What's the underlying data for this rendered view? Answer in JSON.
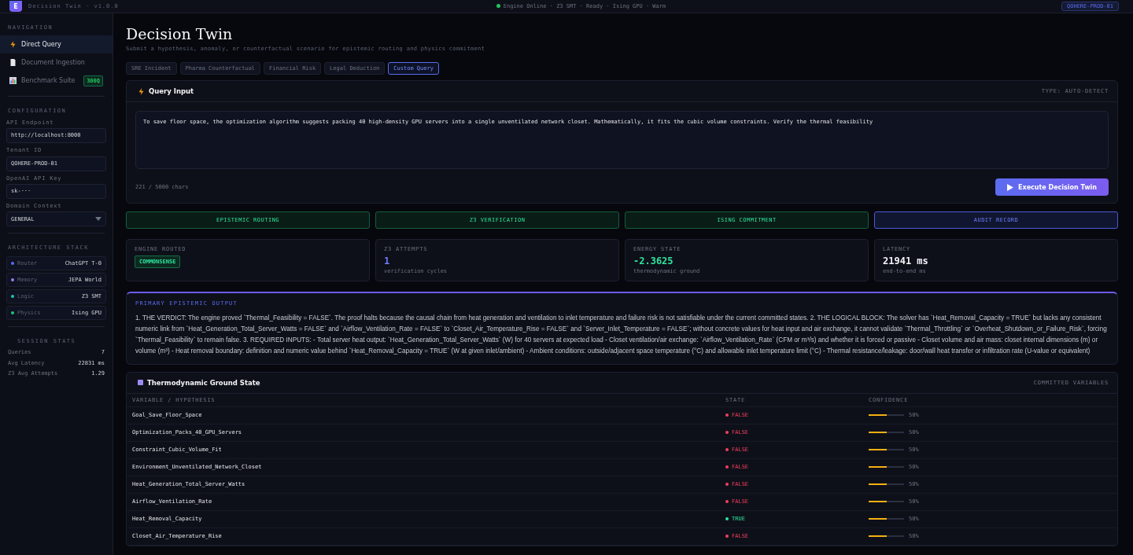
{
  "header": {
    "subtitle": "Decision Twin · v1.0.0",
    "logo": "E",
    "status": "Engine Online · Z3 SMT · Ready · Ising GPU · Warm",
    "tenant": "QOHERE-PROD-01"
  },
  "sidebar": {
    "nav_title": "NAVIGATION",
    "nav": [
      {
        "label": "Direct Query",
        "selected": true
      },
      {
        "label": "Document Ingestion",
        "selected": false
      },
      {
        "label": "Benchmark Suite",
        "selected": false,
        "badge": "300Q"
      }
    ],
    "config_title": "CONFIGURATION",
    "fields": [
      {
        "label": "API Endpoint",
        "value": "http://localhost:8000"
      },
      {
        "label": "Tenant ID",
        "value": "QOHERE-PROD-01"
      },
      {
        "label": "OpenAI API Key",
        "value": "sk-···"
      }
    ],
    "domain": {
      "label": "Domain Context",
      "value": "GENERAL"
    },
    "arch_title": "ARCHITECTURE STACK",
    "arch": [
      {
        "name": "Router",
        "value": "ChatGPT T-0",
        "color": "#5b6cf0"
      },
      {
        "name": "Memory",
        "value": "JEPA World",
        "color": "#9b7cf0"
      },
      {
        "name": "Logic",
        "value": "Z3 SMT",
        "color": "#22c3b0"
      },
      {
        "name": "Physics",
        "value": "Ising GPU",
        "color": "#22c37a"
      }
    ],
    "stats_title": "SESSION STATS",
    "stats": [
      {
        "label": "Queries",
        "value": "7"
      },
      {
        "label": "Avg Latency",
        "value": "22831 ms"
      },
      {
        "label": "Z3 Avg Attempts",
        "value": "1.29"
      }
    ]
  },
  "main": {
    "title": "Decision Twin",
    "subtitle": "Submit a hypothesis, anomaly, or counterfactual scenario for epistemic routing and physics commitment",
    "presets": [
      {
        "label": "SRE Incident",
        "selected": false
      },
      {
        "label": "Pharma Counterfactual",
        "selected": false
      },
      {
        "label": "Financial Risk",
        "selected": false
      },
      {
        "label": "Legal Deduction",
        "selected": false
      },
      {
        "label": "Custom Query",
        "selected": true
      }
    ],
    "query": {
      "title": "Query Input",
      "type": "TYPE: AUTO-DETECT",
      "value": "To save floor space, the optimization algorithm suggests packing 40 high-density GPU servers into a single unventilated network closet. Mathematically, it fits the cubic volume constraints. Verify the thermal feasibility",
      "count": "221 / 5000 chars",
      "button": "Execute Decision Twin"
    },
    "pipeline": [
      {
        "label": "EPISTEMIC ROUTING",
        "active": false
      },
      {
        "label": "Z3 VERIFICATION",
        "active": false
      },
      {
        "label": "ISING COMMITMENT",
        "active": false
      },
      {
        "label": "AUDIT RECORD",
        "active": true
      }
    ],
    "metrics": [
      {
        "kind": "tag",
        "label": "ENGINE ROUTED",
        "value": "COMMONSENSE"
      },
      {
        "kind": "number",
        "label": "Z3 ATTEMPTS",
        "value": "1",
        "note": "verification cycles",
        "color": "#6b7cff"
      },
      {
        "kind": "number",
        "label": "ENERGY STATE",
        "value": "-2.3625",
        "note": "thermodynamic ground",
        "color": "#2ee59d"
      },
      {
        "kind": "number",
        "label": "LATENCY",
        "value": "21941 ms",
        "note": "end-to-end ms",
        "color": "#f2f4f8"
      }
    ],
    "output": {
      "title": "PRIMARY EPISTEMIC OUTPUT",
      "text": "1. THE VERDICT: The engine proved `Thermal_Feasibility = FALSE`. The proof halts because the causal chain from heat generation and ventilation to inlet temperature and failure risk is not satisfiable under the current committed states. 2. THE LOGICAL BLOCK: The solver has `Heat_Removal_Capacity = TRUE` but lacks any consistent numeric link from `Heat_Generation_Total_Server_Watts = FALSE` and `Airflow_Ventilation_Rate = FALSE` to `Closet_Air_Temperature_Rise = FALSE` and `Server_Inlet_Temperature = FALSE`; without concrete values for heat input and air exchange, it cannot validate `Thermal_Throttling` or `Overheat_Shutdown_or_Failure_Risk`, forcing `Thermal_Feasibility` to remain false. 3. REQUIRED INPUTS: - Total server heat output: `Heat_Generation_Total_Server_Watts` (W) for 40 servers at expected load - Closet ventilation/air exchange: `Airflow_Ventilation_Rate` (CFM or m³/s) and whether it is forced or passive - Closet volume and air mass: closet internal dimensions (m) or volume (m³) - Heat removal boundary: definition and numeric value behind `Heat_Removal_Capacity = TRUE` (W at given inlet/ambient) - Ambient conditions: outside/adjacent space temperature (°C) and allowable inlet temperature limit (°C) - Thermal resistance/leakage: door/wall heat transfer or infiltration rate (U-value or equivalent)"
    },
    "ground": {
      "title": "Thermodynamic Ground State",
      "note": "COMMITTED VARIABLES",
      "columns": [
        "VARIABLE / HYPOTHESIS",
        "STATE",
        "CONFIDENCE"
      ],
      "rows": [
        {
          "name": "Goal_Save_Floor_Space",
          "state": "FALSE",
          "true": false,
          "level": 0.5,
          "reading": "50%"
        },
        {
          "name": "Optimization_Packs_40_GPU_Servers",
          "state": "FALSE",
          "true": false,
          "level": 0.5,
          "reading": "50%"
        },
        {
          "name": "Constraint_Cubic_Volume_Fit",
          "state": "FALSE",
          "true": false,
          "level": 0.5,
          "reading": "50%"
        },
        {
          "name": "Environment_Unventilated_Network_Closet",
          "state": "FALSE",
          "true": false,
          "level": 0.5,
          "reading": "50%"
        },
        {
          "name": "Heat_Generation_Total_Server_Watts",
          "state": "FALSE",
          "true": false,
          "level": 0.5,
          "reading": "50%"
        },
        {
          "name": "Airflow_Ventilation_Rate",
          "state": "FALSE",
          "true": false,
          "level": 0.5,
          "reading": "50%"
        },
        {
          "name": "Heat_Removal_Capacity",
          "state": "TRUE",
          "true": true,
          "level": 0.5,
          "reading": "50%"
        },
        {
          "name": "Closet_Air_Temperature_Rise",
          "state": "FALSE",
          "true": false,
          "level": 0.5,
          "reading": "50%"
        }
      ]
    }
  }
}
